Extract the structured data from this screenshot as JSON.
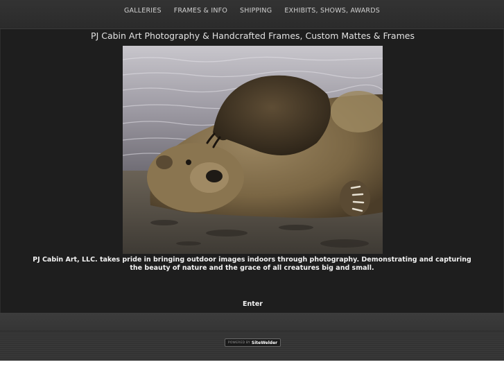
{
  "nav": {
    "items": [
      {
        "label": "GALLERIES"
      },
      {
        "label": "FRAMES & INFO"
      },
      {
        "label": "SHIPPING"
      },
      {
        "label": "EXHIBITS, SHOWS, AWARDS"
      }
    ]
  },
  "main": {
    "title": "PJ Cabin Art Photography & Handcrafted Frames, Custom Mattes & Frames",
    "intro": "PJ Cabin Art, LLC. takes pride in bringing outdoor images indoors through photography.  Demonstrating and capturing the beauty of nature and the grace of all creatures big and small.",
    "enter_label": "Enter"
  },
  "footer": {
    "badge_prefix": "POWERED BY",
    "badge_brand": "SiteWelder"
  },
  "colors": {
    "nav_bg": "#2f2f2f",
    "content_bg": "#1e1e1e",
    "text": "#f2f2f2"
  }
}
